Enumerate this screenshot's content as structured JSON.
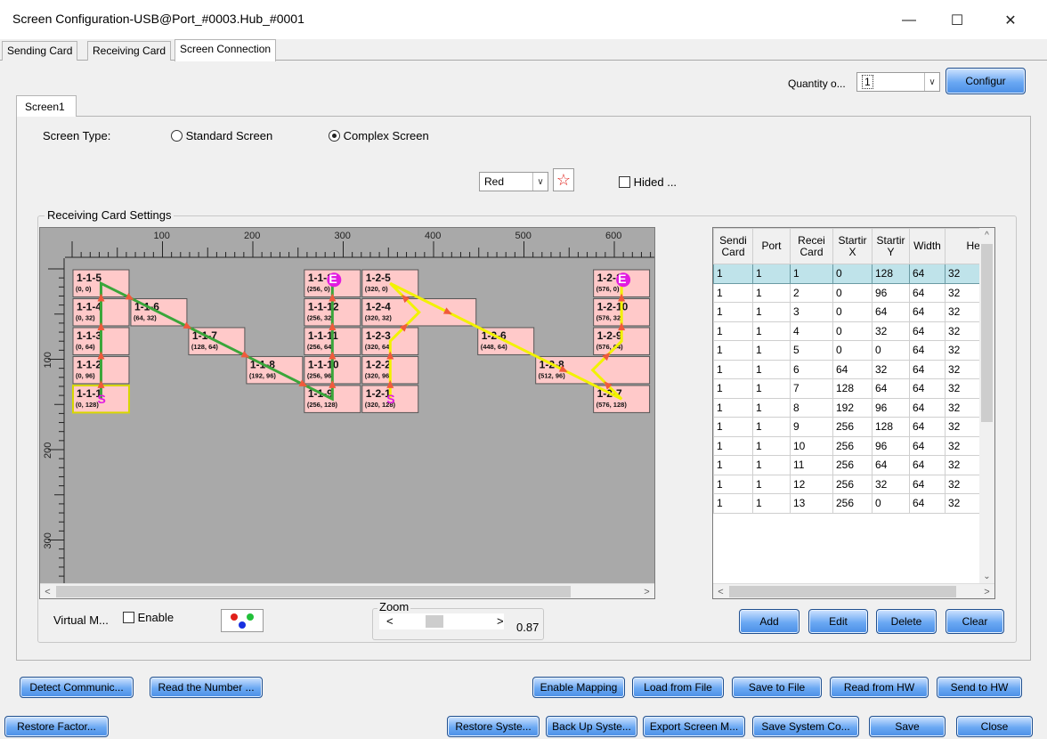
{
  "window": {
    "title": "Screen Configuration-USB@Port_#0003.Hub_#0001",
    "minimize": "—",
    "maximize": "☐",
    "close": "✕"
  },
  "tabs": [
    "Sending Card",
    "Receiving Card",
    "Screen Connection"
  ],
  "quantity": {
    "label": "Quantity o...",
    "value": "1",
    "configure": "Configur"
  },
  "screen_tab": "Screen1",
  "screen_type": {
    "label": "Screen Type:",
    "standard": "Standard Screen",
    "complex": "Complex Screen",
    "selected": "complex"
  },
  "color_select": {
    "value": "Red",
    "star_icon": "star-icon"
  },
  "hided": "Hided ...",
  "group_label": "Receiving Card Settings",
  "ruler": {
    "h_labels": [
      "100",
      "200",
      "300",
      "400",
      "500",
      "600"
    ],
    "v_labels": [
      "100",
      "200",
      "300"
    ]
  },
  "cards": [
    {
      "id": "1-1-5",
      "coord": "(0, 0)"
    },
    {
      "id": "1-1-4",
      "coord": "(0, 32)"
    },
    {
      "id": "1-1-3",
      "coord": "(0, 64)"
    },
    {
      "id": "1-1-2",
      "coord": "(0, 96)"
    },
    {
      "id": "1-1-1",
      "coord": "(0, 128)"
    },
    {
      "id": "1-1-6",
      "coord": "(64, 32)"
    },
    {
      "id": "1-1-7",
      "coord": "(128, 64)"
    },
    {
      "id": "1-1-8",
      "coord": "(192, 96)"
    },
    {
      "id": "1-1-13",
      "coord": "(256, 0)"
    },
    {
      "id": "1-1-12",
      "coord": "(256, 32)"
    },
    {
      "id": "1-1-11",
      "coord": "(256, 64)"
    },
    {
      "id": "1-1-10",
      "coord": "(256, 96)"
    },
    {
      "id": "1-1-9",
      "coord": "(256, 128)"
    },
    {
      "id": "1-2-5",
      "coord": "(320, 0)"
    },
    {
      "id": "1-2-4",
      "coord": "(320, 32)"
    },
    {
      "id": "1-2-3",
      "coord": "(320, 64)"
    },
    {
      "id": "1-2-2",
      "coord": "(320, 96)"
    },
    {
      "id": "1-2-1",
      "coord": "(320, 128)"
    },
    {
      "id": "1-2-6",
      "coord": "(448, 64)"
    },
    {
      "id": "1-2-8",
      "coord": "(512, 96)"
    },
    {
      "id": "1-2-11",
      "coord": "(576, 0)"
    },
    {
      "id": "1-2-10",
      "coord": "(576, 32)"
    },
    {
      "id": "1-2-9",
      "coord": "(576, 64)"
    },
    {
      "id": "1-2-7",
      "coord": "(576, 128)"
    }
  ],
  "markers": {
    "start": "S",
    "end": "E"
  },
  "table": {
    "headers": [
      "Sendi Card",
      "Port",
      "Recei Card",
      "Startir X",
      "Startir Y",
      "Width",
      "Hei"
    ],
    "rows": [
      [
        "1",
        "1",
        "1",
        "0",
        "128",
        "64",
        "32"
      ],
      [
        "1",
        "1",
        "2",
        "0",
        "96",
        "64",
        "32"
      ],
      [
        "1",
        "1",
        "3",
        "0",
        "64",
        "64",
        "32"
      ],
      [
        "1",
        "1",
        "4",
        "0",
        "32",
        "64",
        "32"
      ],
      [
        "1",
        "1",
        "5",
        "0",
        "0",
        "64",
        "32"
      ],
      [
        "1",
        "1",
        "6",
        "64",
        "32",
        "64",
        "32"
      ],
      [
        "1",
        "1",
        "7",
        "128",
        "64",
        "64",
        "32"
      ],
      [
        "1",
        "1",
        "8",
        "192",
        "96",
        "64",
        "32"
      ],
      [
        "1",
        "1",
        "9",
        "256",
        "128",
        "64",
        "32"
      ],
      [
        "1",
        "1",
        "10",
        "256",
        "96",
        "64",
        "32"
      ],
      [
        "1",
        "1",
        "11",
        "256",
        "64",
        "64",
        "32"
      ],
      [
        "1",
        "1",
        "12",
        "256",
        "32",
        "64",
        "32"
      ],
      [
        "1",
        "1",
        "13",
        "256",
        "0",
        "64",
        "32"
      ]
    ],
    "selected_row": 0
  },
  "virtual": {
    "label": "Virtual M...",
    "enable": "Enable",
    "icon": "rgb-dots-icon"
  },
  "zoom": {
    "label": "Zoom",
    "value": "0.87",
    "left": "<",
    "right": ">"
  },
  "table_buttons": [
    "Add",
    "Edit",
    "Delete",
    "Clear"
  ],
  "bottom_row1_left": [
    "Detect Communic...",
    "Read the Number ..."
  ],
  "bottom_row1_right": [
    "Enable Mapping",
    "Load from File",
    "Save to File",
    "Read from HW",
    "Send to HW"
  ],
  "bottom_row2_left": [
    "Restore Factor..."
  ],
  "bottom_row2_right": [
    "Restore Syste...",
    "Back Up Syste...",
    "Export Screen M...",
    "Save System Co...",
    "Save",
    "Close"
  ],
  "colors": {
    "card_fill": "#ffc9c9",
    "path_green": "#3aa63a",
    "path_yellow": "#f2f200",
    "arrow_red": "#f05a3c",
    "marker_magenta": "#e21be0"
  }
}
